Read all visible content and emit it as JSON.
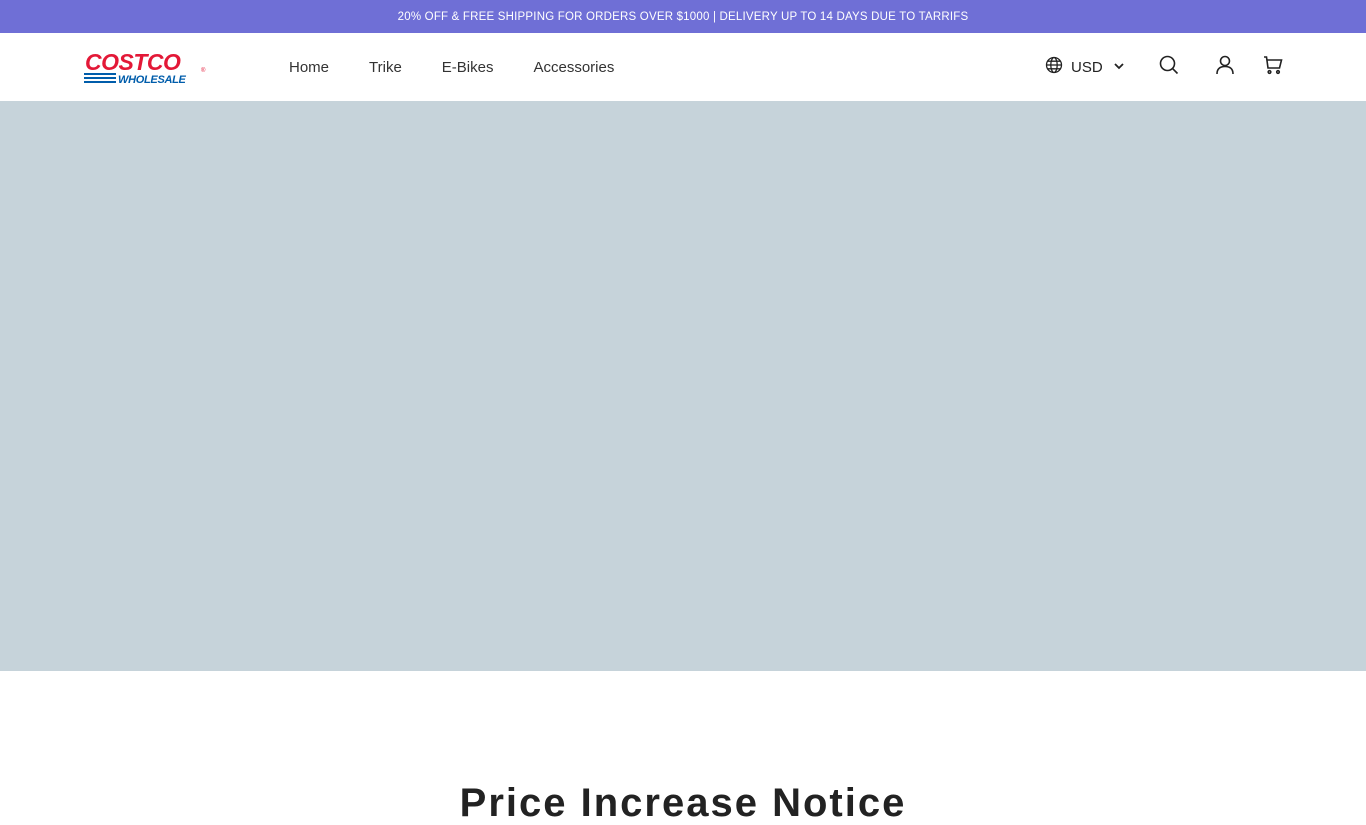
{
  "announcement": {
    "text": "20% OFF & FREE SHIPPING FOR ORDERS OVER $1000 | DELIVERY UP TO 14 DAYS DUE TO TARRIFS"
  },
  "header": {
    "logo": {
      "top_text": "COSTCO",
      "bottom_text": "WHOLESALE",
      "red": "#e31837",
      "blue": "#005dab"
    },
    "nav": [
      {
        "label": "Home"
      },
      {
        "label": "Trike"
      },
      {
        "label": "E-Bikes"
      },
      {
        "label": "Accessories"
      }
    ],
    "currency": {
      "label": "USD",
      "icon": "globe-icon"
    },
    "icons": [
      "search-icon",
      "account-icon",
      "cart-icon"
    ]
  },
  "hero": {
    "background": "#c6d3da"
  },
  "section": {
    "title": "Price Increase Notice"
  },
  "colors": {
    "announcement_bg": "#6f6fd6",
    "text": "#222222"
  }
}
